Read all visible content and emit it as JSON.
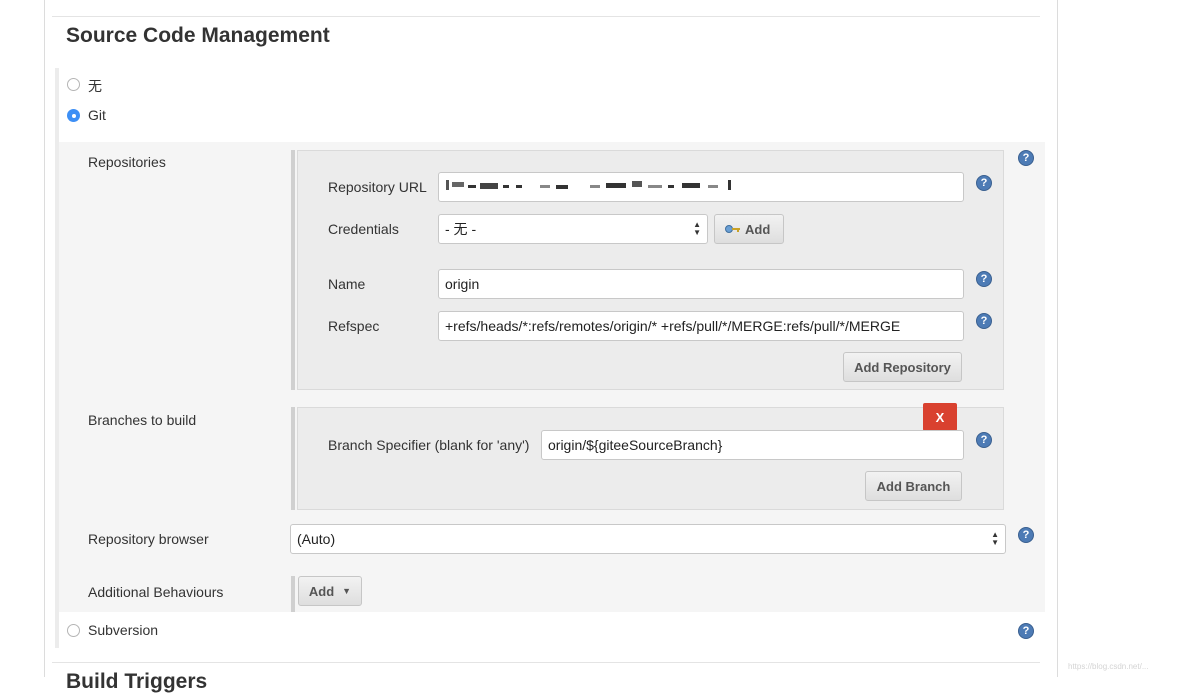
{
  "section": {
    "title": "Source Code Management",
    "next_title": "Build Triggers"
  },
  "scm_options": {
    "none_label": "无",
    "git_label": "Git",
    "subversion_label": "Subversion",
    "selected": "Git"
  },
  "repositories": {
    "label": "Repositories",
    "url_label": "Repository URL",
    "url_value": "",
    "credentials_label": "Credentials",
    "credentials_value": "- 无 -",
    "add_credentials_label": "Add",
    "name_label": "Name",
    "name_value": "origin",
    "refspec_label": "Refspec",
    "refspec_value": "+refs/heads/*:refs/remotes/origin/* +refs/pull/*/MERGE:refs/pull/*/MERGE",
    "add_repository_label": "Add Repository"
  },
  "branches": {
    "label": "Branches to build",
    "delete_label": "X",
    "specifier_label": "Branch Specifier (blank for 'any')",
    "specifier_value": "origin/${giteeSourceBranch}",
    "add_branch_label": "Add Branch"
  },
  "repository_browser": {
    "label": "Repository browser",
    "value": "(Auto)"
  },
  "additional_behaviours": {
    "label": "Additional Behaviours",
    "add_label": "Add"
  },
  "help_icon_label": "?",
  "watermark": "https://blog.csdn.net/...",
  "colors": {
    "accent": "#3d8ff5",
    "help": "#4d7bb5",
    "delete": "#d9412f"
  }
}
